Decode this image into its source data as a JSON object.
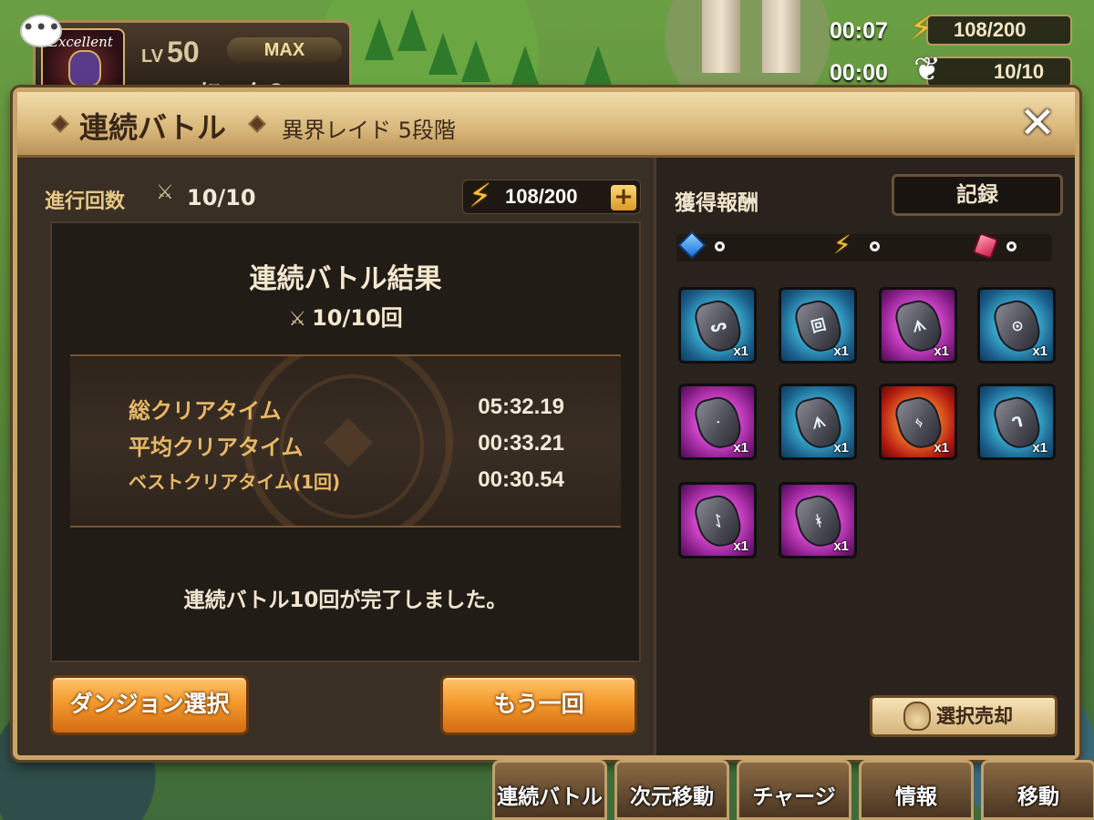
{
  "hud": {
    "level_prefix": "LV",
    "level": "50",
    "max_label": "MAX",
    "player_name": "にょん®",
    "avatar_text": "Excellent",
    "timer_energy": "00:07",
    "energy": "108/200",
    "timer_wings": "00:00",
    "wings": "10/10"
  },
  "dialog": {
    "title": "連続バトル",
    "subtitle": "異界レイド 5段階",
    "close_icon": "✕",
    "progress_label": "進行回数",
    "progress_value": "10/10",
    "energy_value": "108/200",
    "plus": "+",
    "result": {
      "title": "連続バトル結果",
      "count": "10/10回",
      "stats": [
        {
          "label": "総クリアタイム",
          "value": "05:32.19"
        },
        {
          "label": "平均クリアタイム",
          "value": "00:33.21"
        },
        {
          "label": "ベストクリアタイム(1回)",
          "value": "00:30.54"
        }
      ],
      "message": "連続バトル10回が完了しました。"
    },
    "buttons": {
      "dungeon_select": "ダンジョン選択",
      "again": "もう一回"
    },
    "rewards": {
      "label": "獲得報酬",
      "record_button": "記録",
      "currency": [
        {
          "icon": "blue-crystal-icon",
          "value": "0"
        },
        {
          "icon": "energy-bolt-icon",
          "value": "0"
        },
        {
          "icon": "red-crystal-icon",
          "value": "0"
        }
      ],
      "runes": [
        {
          "color": "blue",
          "glyph": "ᔕ",
          "qty": "x1"
        },
        {
          "color": "blue",
          "glyph": "回",
          "qty": "x1"
        },
        {
          "color": "purple",
          "glyph": "ᗑ",
          "qty": "x1"
        },
        {
          "color": "blue",
          "glyph": "⊙",
          "qty": "x1"
        },
        {
          "color": "purple",
          "glyph": "ᐧ",
          "qty": "x1"
        },
        {
          "color": "blue",
          "glyph": "ᗑ",
          "qty": "x1"
        },
        {
          "color": "red",
          "glyph": "ᛃ",
          "qty": "x1"
        },
        {
          "color": "blue",
          "glyph": "ᒉ",
          "qty": "x1"
        },
        {
          "color": "purple",
          "glyph": "ᛇ",
          "qty": "x1"
        },
        {
          "color": "purple",
          "glyph": "ᚼ",
          "qty": "x1"
        }
      ],
      "sell_button": "選択売却"
    }
  },
  "bottom_menu": [
    {
      "label": "連続バトル"
    },
    {
      "label": "次元移動"
    },
    {
      "label": "チャージ"
    },
    {
      "label": "情報"
    },
    {
      "label": "移動"
    }
  ],
  "colors": {
    "accent_orange": "#f39a2e",
    "gold_text": "#e8b866",
    "frame_gold": "#c8a56b",
    "panel_dark": "#221c17"
  }
}
